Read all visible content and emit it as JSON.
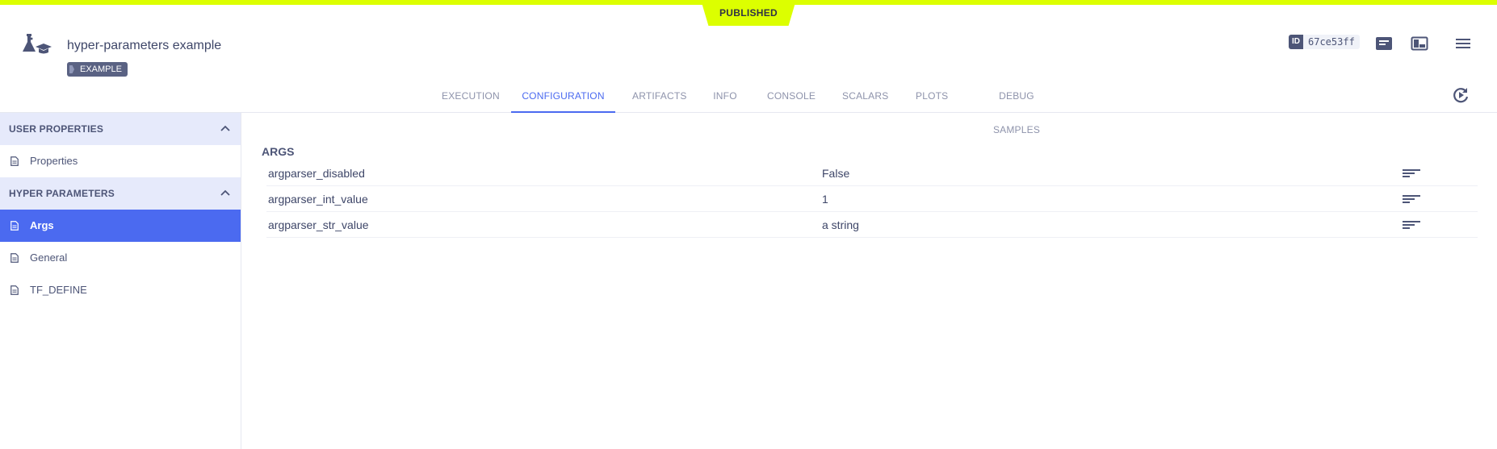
{
  "status_banner": "PUBLISHED",
  "task": {
    "title": "hyper-parameters example",
    "tag": "EXAMPLE",
    "id_label": "ID",
    "id_value": "67ce53ff"
  },
  "tabs": [
    {
      "label": "EXECUTION",
      "active": false
    },
    {
      "label": "CONFIGURATION",
      "active": true
    },
    {
      "label": "ARTIFACTS",
      "active": false
    },
    {
      "label": "INFO",
      "active": false
    },
    {
      "label": "CONSOLE",
      "active": false
    },
    {
      "label": "SCALARS",
      "active": false
    },
    {
      "label": "PLOTS",
      "active": false
    },
    {
      "label": "DEBUG SAMPLES",
      "active": false
    }
  ],
  "sidebar": {
    "sections": [
      {
        "title": "USER PROPERTIES",
        "items": [
          {
            "label": "Properties",
            "active": false
          }
        ]
      },
      {
        "title": "HYPER PARAMETERS",
        "items": [
          {
            "label": "Args",
            "active": true
          },
          {
            "label": "General",
            "active": false
          },
          {
            "label": "TF_DEFINE",
            "active": false
          }
        ]
      }
    ]
  },
  "main": {
    "section_title": "ARGS",
    "rows": [
      {
        "key": "argparser_disabled",
        "value": "False"
      },
      {
        "key": "argparser_int_value",
        "value": "1"
      },
      {
        "key": "argparser_str_value",
        "value": "a string"
      }
    ]
  },
  "icons": {
    "task_type": "experiment-flask-icon",
    "details": "details-panel-icon",
    "layout": "layout-toggle-icon",
    "menu": "hamburger-menu-icon",
    "refresh": "auto-refresh-icon",
    "row_action": "description-lines-icon"
  },
  "colors": {
    "accent": "#4b6af0",
    "banner": "#dcff00",
    "section_bg": "#e6eafb",
    "text": "#4d5577"
  }
}
